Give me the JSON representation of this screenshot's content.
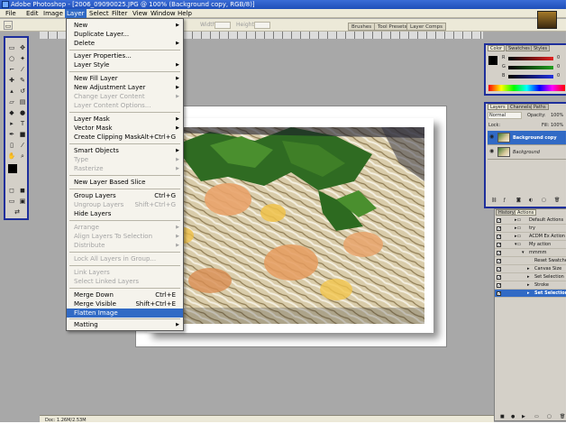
{
  "window": {
    "title": "Adobe Photoshop - [2006_09090025.JPG @ 100% (Background copy, RGB/8)]"
  },
  "menubar": {
    "items": [
      "File",
      "Edit",
      "Image",
      "Layer",
      "Select",
      "Filter",
      "View",
      "Window",
      "Help"
    ],
    "active_index": 3
  },
  "options_bar": {
    "width_label": "Width:",
    "height_label": "Height:"
  },
  "palette_well": {
    "tabs": [
      "Brushes",
      "Tool Presets",
      "Layer Comps"
    ]
  },
  "layer_menu": {
    "items": [
      {
        "label": "New",
        "arrow": true,
        "shortcut": "",
        "disabled": false
      },
      {
        "label": "Duplicate Layer...",
        "arrow": false,
        "shortcut": "",
        "disabled": false
      },
      {
        "label": "Delete",
        "arrow": true,
        "shortcut": "",
        "disabled": false
      },
      {
        "label": "Layer Properties...",
        "arrow": false,
        "shortcut": "",
        "disabled": false
      },
      {
        "label": "Layer Style",
        "arrow": true,
        "shortcut": "",
        "disabled": false
      },
      {
        "label": "New Fill Layer",
        "arrow": true,
        "shortcut": "",
        "disabled": false
      },
      {
        "label": "New Adjustment Layer",
        "arrow": true,
        "shortcut": "",
        "disabled": false
      },
      {
        "label": "Change Layer Content",
        "arrow": true,
        "shortcut": "",
        "disabled": true
      },
      {
        "label": "Layer Content Options...",
        "arrow": false,
        "shortcut": "",
        "disabled": true
      },
      {
        "label": "Layer Mask",
        "arrow": true,
        "shortcut": "",
        "disabled": false
      },
      {
        "label": "Vector Mask",
        "arrow": true,
        "shortcut": "",
        "disabled": false
      },
      {
        "label": "Create Clipping Mask",
        "arrow": false,
        "shortcut": "Alt+Ctrl+G",
        "disabled": false
      },
      {
        "label": "Smart Objects",
        "arrow": true,
        "shortcut": "",
        "disabled": false
      },
      {
        "label": "Type",
        "arrow": true,
        "shortcut": "",
        "disabled": true
      },
      {
        "label": "Rasterize",
        "arrow": true,
        "shortcut": "",
        "disabled": true
      },
      {
        "label": "New Layer Based Slice",
        "arrow": false,
        "shortcut": "",
        "disabled": false
      },
      {
        "label": "Group Layers",
        "arrow": false,
        "shortcut": "Ctrl+G",
        "disabled": false
      },
      {
        "label": "Ungroup Layers",
        "arrow": false,
        "shortcut": "Shift+Ctrl+G",
        "disabled": true
      },
      {
        "label": "Hide Layers",
        "arrow": false,
        "shortcut": "",
        "disabled": false
      },
      {
        "label": "Arrange",
        "arrow": true,
        "shortcut": "",
        "disabled": true
      },
      {
        "label": "Align Layers To Selection",
        "arrow": true,
        "shortcut": "",
        "disabled": true
      },
      {
        "label": "Distribute",
        "arrow": true,
        "shortcut": "",
        "disabled": true
      },
      {
        "label": "Lock All Layers in Group...",
        "arrow": false,
        "shortcut": "",
        "disabled": true
      },
      {
        "label": "Link Layers",
        "arrow": false,
        "shortcut": "",
        "disabled": true
      },
      {
        "label": "Select Linked Layers",
        "arrow": false,
        "shortcut": "",
        "disabled": true
      },
      {
        "label": "Merge Down",
        "arrow": false,
        "shortcut": "Ctrl+E",
        "disabled": false
      },
      {
        "label": "Merge Visible",
        "arrow": false,
        "shortcut": "Shift+Ctrl+E",
        "disabled": false
      },
      {
        "label": "Flatten Image",
        "arrow": false,
        "shortcut": "",
        "disabled": false,
        "highlighted": true
      },
      {
        "label": "Matting",
        "arrow": true,
        "shortcut": "",
        "disabled": false
      }
    ]
  },
  "color_panel": {
    "tabs": [
      "Color",
      "Swatches",
      "Styles"
    ],
    "channels": [
      {
        "label": "R",
        "value": "0",
        "color": "#e02020"
      },
      {
        "label": "G",
        "value": "0",
        "color": "#20a020"
      },
      {
        "label": "B",
        "value": "0",
        "color": "#2030e0"
      }
    ]
  },
  "layers_panel": {
    "tabs": [
      "Layers",
      "Channels",
      "Paths"
    ],
    "blend_mode": "Normal",
    "opacity_label": "Opacity:",
    "opacity_value": "100%",
    "lock_label": "Lock:",
    "fill_label": "Fill:",
    "fill_value": "100%",
    "layers": [
      {
        "name": "Background copy",
        "selected": true
      },
      {
        "name": "Background",
        "selected": false
      }
    ]
  },
  "actions_panel": {
    "tabs": [
      "History",
      "Actions"
    ],
    "rows": [
      {
        "label": "Default Actions",
        "kind": "folder",
        "selected": false
      },
      {
        "label": "try",
        "kind": "folder",
        "selected": false
      },
      {
        "label": "ACDM Ex Action",
        "kind": "folder",
        "selected": false
      },
      {
        "label": "My action",
        "kind": "folder",
        "selected": false
      },
      {
        "label": "mmmm",
        "kind": "action",
        "selected": false
      },
      {
        "label": "Reset Swatches",
        "kind": "step",
        "selected": false
      },
      {
        "label": "Canvas Size",
        "kind": "step",
        "selected": false
      },
      {
        "label": "Set Selection",
        "kind": "step",
        "selected": false
      },
      {
        "label": "Stroke",
        "kind": "step",
        "selected": false
      },
      {
        "label": "Set Selection",
        "kind": "step",
        "selected": true
      }
    ]
  },
  "status_bar": {
    "doc_info": "Doc: 1.26M/2.53M"
  },
  "colors": {
    "menu_highlight": "#316ac5",
    "panel_border": "#1e2f9c",
    "workspace": "#a8a8a8"
  }
}
